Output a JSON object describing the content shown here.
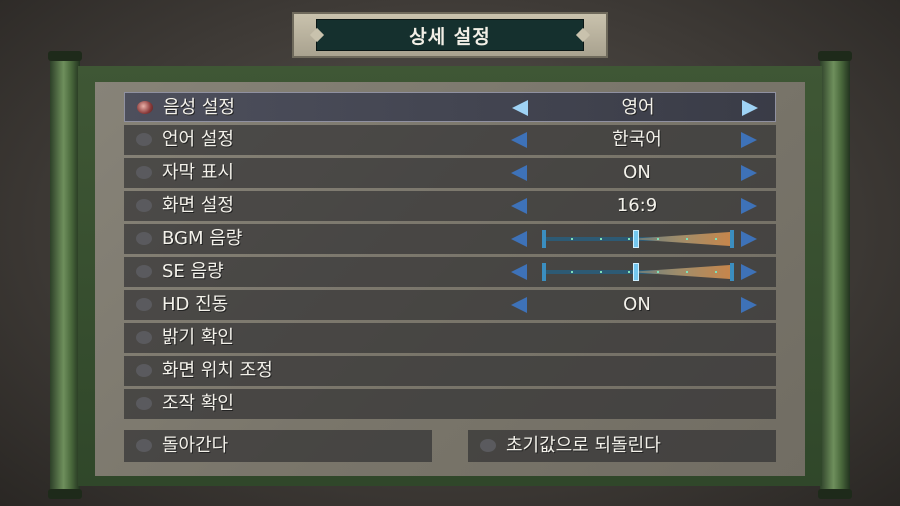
{
  "title": "상세 설정",
  "colors": {
    "arrow": "#3e72b8",
    "arrow_selected": "#9fd3f5",
    "highlight": "#4d4f5c"
  },
  "settings": [
    {
      "label": "음성 설정",
      "value": "영어",
      "selected": true
    },
    {
      "label": "언어 설정",
      "value": "한국어"
    },
    {
      "label": "자막 표시",
      "value": "ON"
    },
    {
      "label": "화면 설정",
      "value": "16:9"
    },
    {
      "label": "BGM 음량",
      "level": 0.49
    },
    {
      "label": "SE 음량",
      "level": 0.49
    },
    {
      "label": "HD 진동",
      "value": "ON"
    },
    {
      "label": "밝기 확인"
    },
    {
      "label": "화면 위치 조정"
    },
    {
      "label": "조작 확인"
    }
  ],
  "buttons": {
    "back": "돌아간다",
    "reset": "초기값으로 되돌린다"
  }
}
